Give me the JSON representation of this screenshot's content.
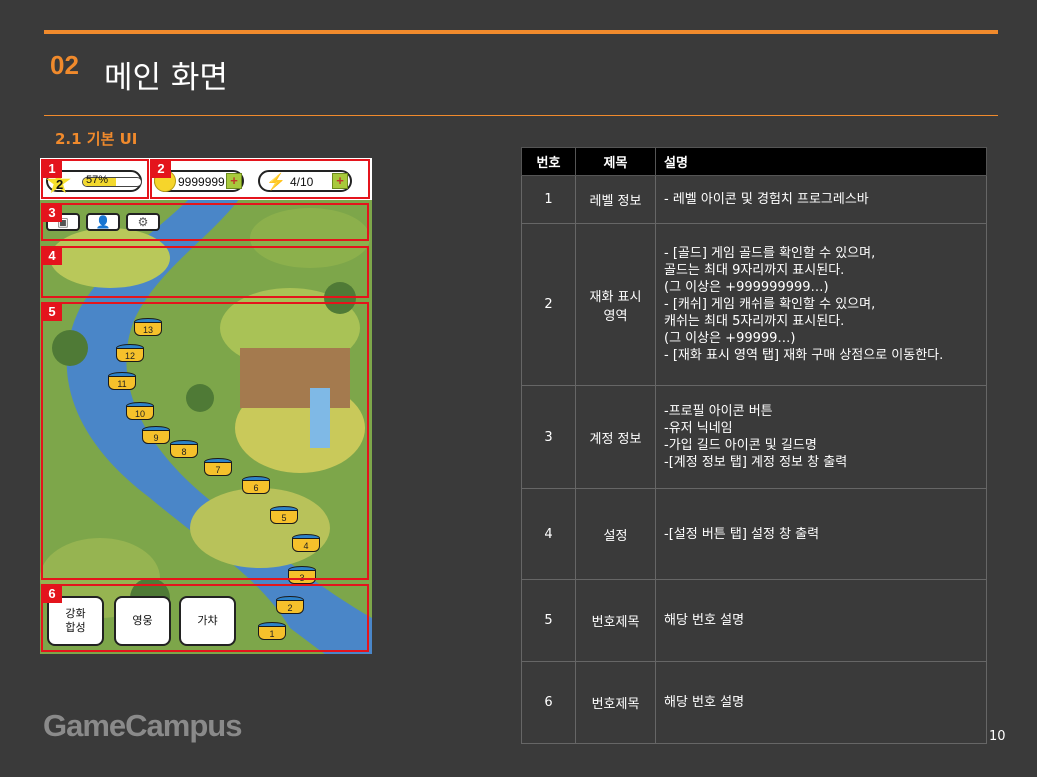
{
  "header": {
    "section_number": "02",
    "section_title": "메인 화면",
    "subsection_title": "2.1 기본 UI"
  },
  "mockup": {
    "level": "2",
    "xp_percent_label": "57%",
    "xp_fraction": 0.57,
    "gold": "9999999",
    "energy": "4/10",
    "plus_icon": "plus-icon",
    "badges": [
      "1",
      "2",
      "3",
      "4",
      "5",
      "6"
    ],
    "stages": [
      "13",
      "12",
      "11",
      "10",
      "9",
      "8",
      "7",
      "6",
      "5",
      "4",
      "3",
      "2",
      "1"
    ],
    "menu_buttons": [
      {
        "label": "강화\n합성"
      },
      {
        "label": "영웅"
      },
      {
        "label": "가챠"
      }
    ],
    "colors": {
      "accent": "#f08a2c",
      "highlight": "#e4141c"
    }
  },
  "table": {
    "headers": [
      "번호",
      "제목",
      "설명"
    ],
    "rows": [
      {
        "num": "1",
        "title": "레벨 정보",
        "desc": "- 레벨 아이콘 및 경험치 프로그레스바"
      },
      {
        "num": "2",
        "title": "재화 표시\n영역",
        "desc": "- [골드] 게임 골드를 확인할 수 있으며,\n   골드는 최대 9자리까지 표시된다.\n   (그 이상은 +999999999…)\n- [캐쉬] 게임 캐쉬를 확인할 수 있으며,\n   캐쉬는 최대 5자리까지 표시된다.\n   (그 이상은 +99999…)\n- [재화 표시 영역 탭] 재화 구매 상점으로 이동한다."
      },
      {
        "num": "3",
        "title": "계정 정보",
        "desc": "-프로필 아이콘 버튼\n-유저 닉네임\n-가입 길드 아이콘 및 길드명\n-[계정 정보 탭] 계정 정보 창 출력"
      },
      {
        "num": "4",
        "title": "설정",
        "desc": "-[설정 버튼 탭] 설정 창 출력"
      },
      {
        "num": "5",
        "title": "번호제목",
        "desc": "해당 번호 설명"
      },
      {
        "num": "6",
        "title": "번호제목",
        "desc": "해당 번호 설명"
      }
    ]
  },
  "footer": {
    "logo": "GameCampus",
    "page_number": "10"
  }
}
